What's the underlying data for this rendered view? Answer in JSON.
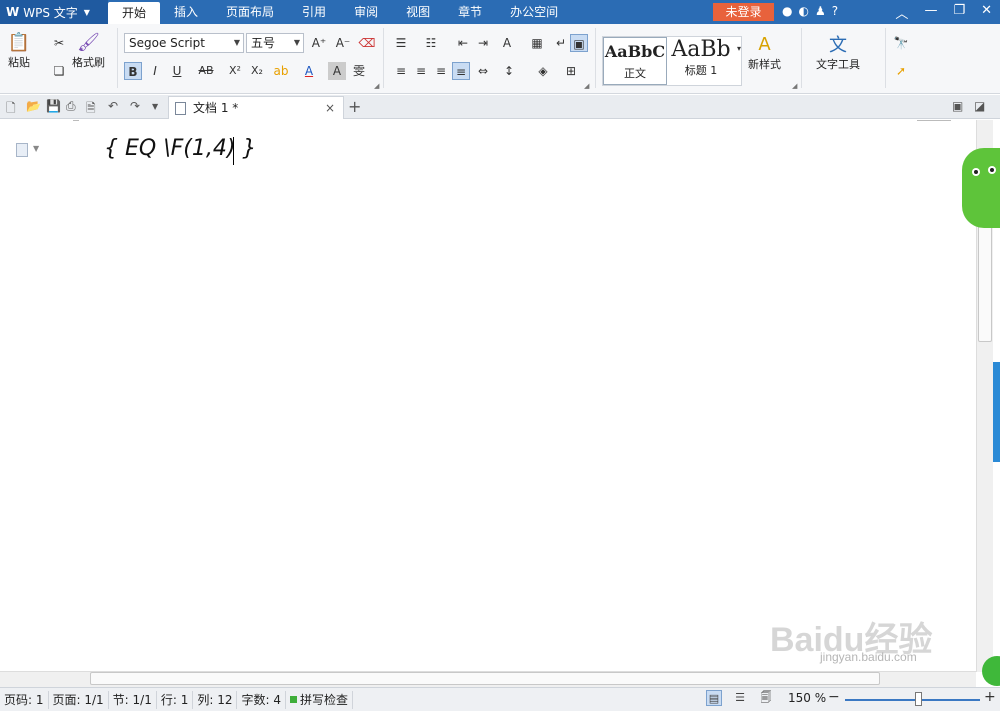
{
  "menubar": {
    "app_logo": "W",
    "app_name": "WPS 文字",
    "tabs": [
      "开始",
      "插入",
      "页面布局",
      "引用",
      "审阅",
      "视图",
      "章节",
      "办公空间"
    ],
    "login": "未登录",
    "help": "?"
  },
  "ribbon": {
    "paste": "粘贴",
    "format_painter": "格式刷",
    "font_name": "Segoe Script",
    "font_size": "五号",
    "bold": "B",
    "italic": "I",
    "underline": "U",
    "strike": "AB",
    "superscript": "X²",
    "subscript": "X₂",
    "style_normal_sample": "AaBbC",
    "style_normal_name": "正文",
    "style_h1_sample": "AaBb",
    "style_h1_name": "标题 1",
    "new_style": "新样式",
    "text_tools": "文字工具"
  },
  "docbar": {
    "doc_title": "文档 1 *",
    "close": "×",
    "new_tab": "+"
  },
  "document": {
    "field_text": "{ EQ \\F(1,4) }"
  },
  "status": {
    "page": "页码: 1",
    "pages": "页面: 1/1",
    "section": "节: 1/1",
    "row": "行: 1",
    "col": "列: 12",
    "words": "字数: 4",
    "spell": "拼写检查",
    "zoom": "150 %"
  },
  "watermark": {
    "brand": "Baidu经验",
    "url": "jingyan.baidu.com"
  },
  "colors": {
    "menubar": "#2b6cb4",
    "login": "#e8623c",
    "spell_ok": "#3fae3a"
  }
}
